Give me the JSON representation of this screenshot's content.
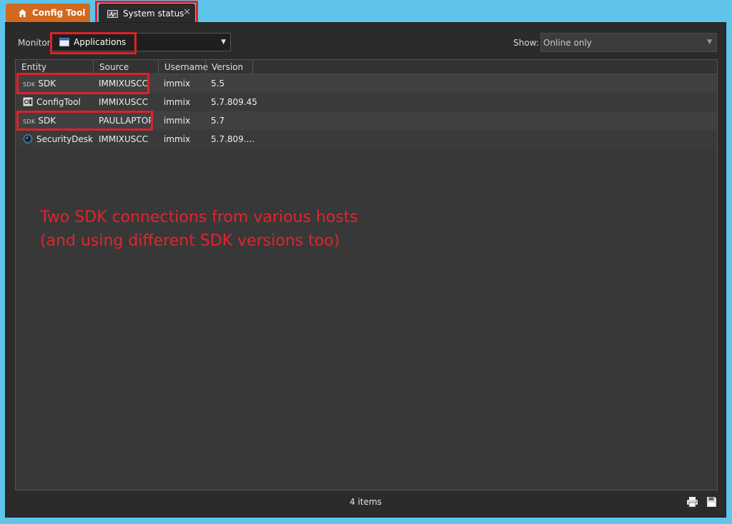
{
  "tabs": {
    "home_label": "Config Tool",
    "status_label": "System status",
    "close_glyph": "✕"
  },
  "toolbar": {
    "monitor_label": "Monitor:",
    "monitor_value": "Applications",
    "show_label": "Show:",
    "show_value": "Online only"
  },
  "table": {
    "columns": [
      "Entity",
      "Source",
      "Username",
      "Version"
    ],
    "rows": [
      {
        "icon": "sdk-icon",
        "tag": "SDK",
        "entity": "SDK",
        "source": "IMMIXUSCC",
        "username": "immix",
        "version": "5.5"
      },
      {
        "icon": "config-tool-icon",
        "tag": "",
        "entity": "ConfigTool",
        "source": "IMMIXUSCC",
        "username": "immix",
        "version": "5.7.809.45"
      },
      {
        "icon": "sdk-icon",
        "tag": "SDK",
        "entity": "SDK",
        "source": "PAULLAPTOP",
        "username": "immix",
        "version": "5.7"
      },
      {
        "icon": "security-desk-icon",
        "tag": "",
        "entity": "SecurityDesk",
        "source": "IMMIXUSCC",
        "username": "immix",
        "version": "5.7.809...."
      }
    ]
  },
  "annotation": {
    "line1": "Two SDK connections from various hosts",
    "line2": "(and using different SDK versions too)",
    "color": "#e2242c"
  },
  "status_bar": {
    "count_text": "4 items"
  },
  "colors": {
    "background": "#5fc4ea",
    "home_tab": "#d2691e",
    "panel": "#2b2b2b",
    "highlight": "#e0202a"
  }
}
